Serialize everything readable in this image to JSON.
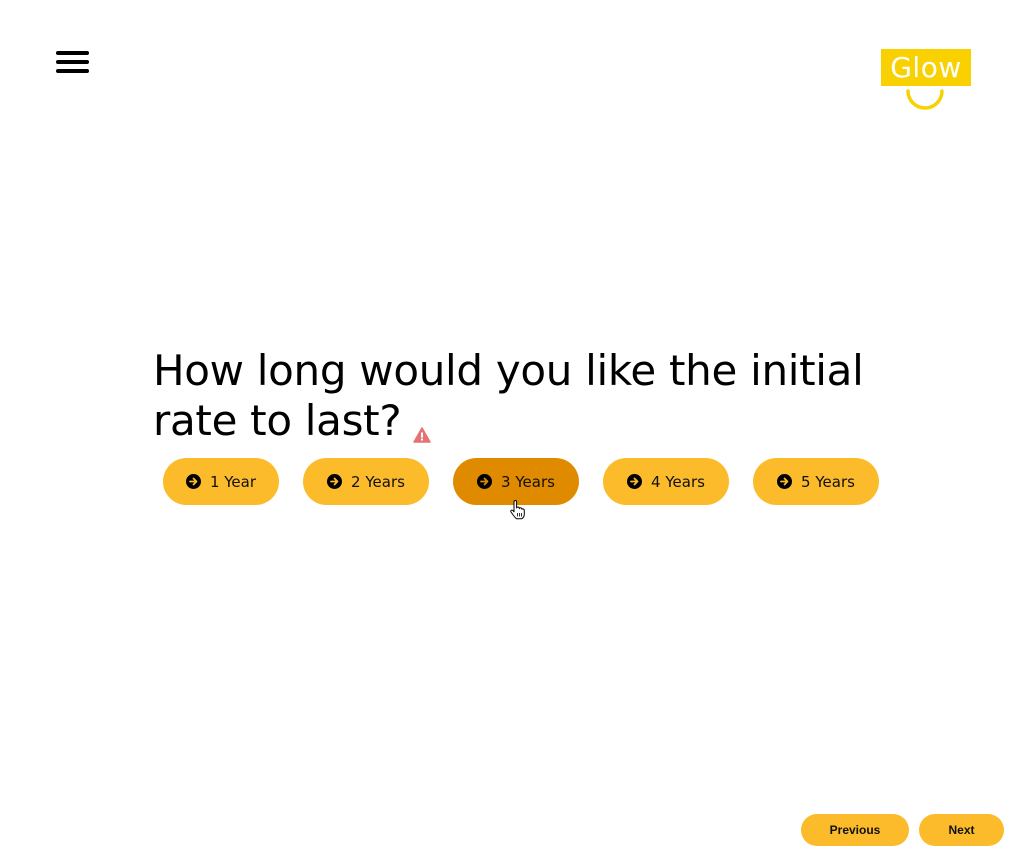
{
  "header": {
    "menu_icon": "hamburger-menu-icon",
    "logo_text": "Glow",
    "logo_color": "#f9d100"
  },
  "question": {
    "text": "How long would you like the initial rate to last?",
    "line1": "How long would you like the initial",
    "line2": "rate to last?",
    "warning_icon": "warning-triangle-icon",
    "warning_color": "#e57373"
  },
  "options": [
    {
      "label": "1 Year",
      "icon": "arrow-right-circle-icon",
      "selected": false
    },
    {
      "label": "2 Years",
      "icon": "arrow-right-circle-icon",
      "selected": false
    },
    {
      "label": "3 Years",
      "icon": "arrow-right-circle-icon",
      "selected": true
    },
    {
      "label": "4 Years",
      "icon": "arrow-right-circle-icon",
      "selected": false
    },
    {
      "label": "5 Years",
      "icon": "arrow-right-circle-icon",
      "selected": false
    }
  ],
  "colors": {
    "button": "#fbbb2b",
    "button_hover": "#e08a00"
  },
  "navigation": {
    "previous_label": "Previous",
    "next_label": "Next"
  }
}
